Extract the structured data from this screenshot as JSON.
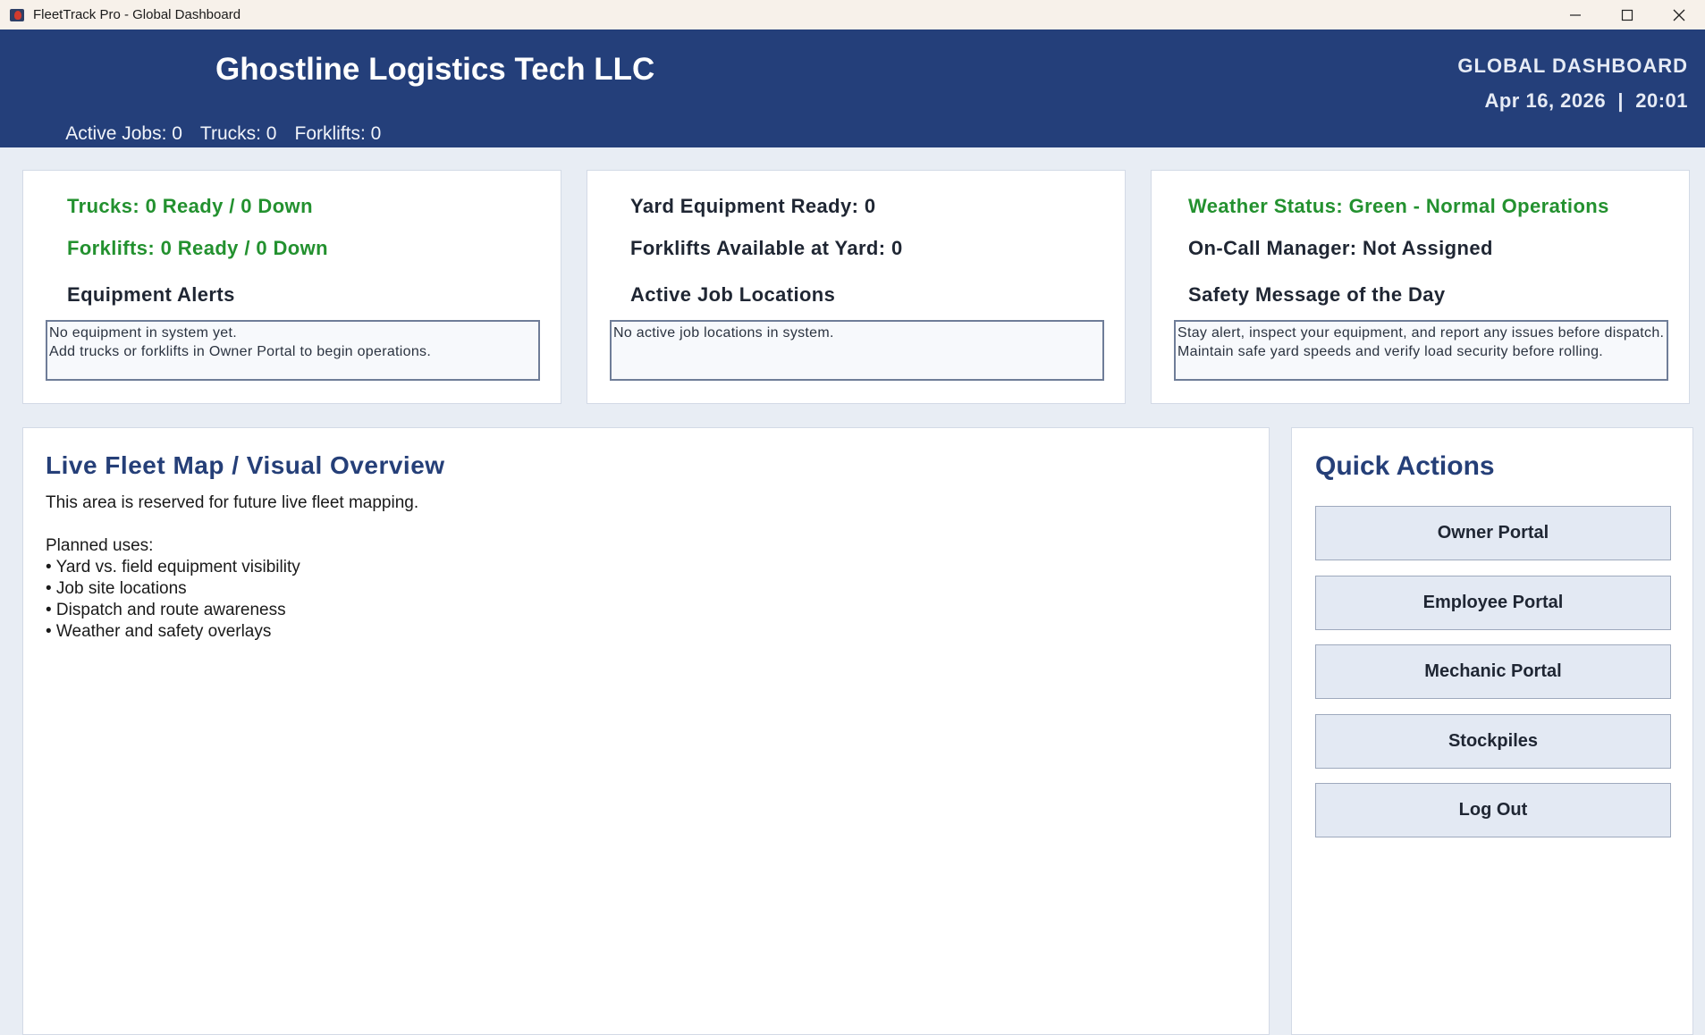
{
  "window": {
    "title": "FleetTrack Pro - Global Dashboard",
    "controls": [
      "minimize-icon",
      "maximize-icon",
      "close-icon"
    ]
  },
  "header": {
    "company": "Ghostline Logistics Tech LLC",
    "active_jobs": "Active Jobs: 0",
    "trucks": "Trucks: 0",
    "forklifts": "Forklifts: 0",
    "dashboard_label": "GLOBAL DASHBOARD",
    "datetime": "Apr 16, 2026  |  20:01"
  },
  "cards": {
    "equipment": {
      "trucks_status": "Trucks: 0 Ready / 0 Down",
      "forklifts_status": "Forklifts: 0 Ready / 0 Down",
      "alerts_heading": "Equipment Alerts",
      "alerts_text": "No equipment in system yet.\nAdd trucks or forklifts in Owner Portal to begin operations."
    },
    "yard": {
      "yard_ready": "Yard Equipment Ready: 0",
      "forklifts_available": "Forklifts Available at Yard: 0",
      "locations_heading": "Active Job Locations",
      "locations_text": "No active job locations in system."
    },
    "weather": {
      "weather_status": "Weather Status: Green - Normal Operations",
      "on_call": "On-Call Manager: Not Assigned",
      "safety_heading": "Safety Message of the Day",
      "safety_text": "Stay alert, inspect your equipment, and report any issues before dispatch. Maintain safe yard speeds and verify load security before rolling."
    }
  },
  "map": {
    "title": "Live Fleet Map / Visual Overview",
    "body": "This area is reserved for future live fleet mapping.\n\nPlanned uses:\n• Yard vs. field equipment visibility\n• Job site locations\n• Dispatch and route awareness\n• Weather and safety overlays"
  },
  "quick_actions": {
    "title": "Quick Actions",
    "buttons": [
      "Owner Portal",
      "Employee Portal",
      "Mechanic Portal",
      "Stockpiles",
      "Log Out"
    ]
  },
  "colors": {
    "header_bg": "#243f7a",
    "status_green": "#23912f",
    "heading_blue": "#253f78",
    "page_bg": "#e8edf4"
  }
}
